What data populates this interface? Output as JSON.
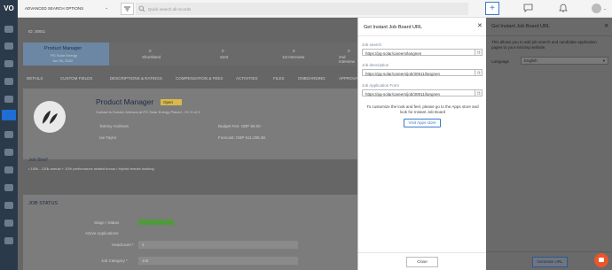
{
  "app": {
    "logo": "VO"
  },
  "topbar": {
    "search_options": "ADVANCED SEARCH OPTIONS",
    "search_placeholder": "Quick search all records"
  },
  "job": {
    "id_label": "ID: 30911",
    "title": "Product Manager",
    "status": "Open",
    "contact": "Contact is Donald Johnson at PG Solar Energy Placed - HC 0 of 3",
    "owner1": "Tammy Andrews",
    "owner2": "Ian Taylor",
    "budget_label": "Budget Fee: GBP 65.00",
    "forecast_label": "Forecast: GBP 611,295.38",
    "brief_title": "Job Brief",
    "brief_text": "• 100k - 120k annual + 10% performance related bonus • Hybrid remote working",
    "section_title": "JOB STATUS",
    "stage_label": "Stage / Status",
    "active_label": "Active Applications",
    "headcount_label": "Headcount *",
    "headcount_value": "3",
    "category_label": "Job Category *",
    "category_value": "Job"
  },
  "pipeline": {
    "stage1": "Product Manager",
    "stage1_sub": "PG Solar Energy",
    "stage1_date": "Jun 30, 2022",
    "stages": [
      {
        "label": "Shortlisted",
        "count": "0"
      },
      {
        "label": "Sent",
        "count": "0"
      },
      {
        "label": "1st Interview",
        "count": "0"
      },
      {
        "label": "2nd Interview",
        "count": "0"
      }
    ]
  },
  "tabs": [
    "DETAILS",
    "CUSTOM FIELDS",
    "DESCRIPTIONS & RATINGS",
    "COMPENSATION & FEES",
    "ACTIVITIES",
    "FILES",
    "ONBOARDING",
    "APPROVALS"
  ],
  "modal": {
    "title": "Get Instant Job Board URL",
    "close_symbol": "✕",
    "job_search_label": "Job search",
    "job_search_value": "https://pg-solar/careers/langnen",
    "job_description_label": "Job description",
    "job_description_value": "https://pg-solar/careers/job/30911/langnen",
    "job_application_label": "Job Application Form",
    "job_application_value": "https://pg-solar/careers/job/30911/langnen",
    "copy_symbol": "❐",
    "info_text": "To customize the look and feel, please go to the Apps store and look for Instant Job Board",
    "visit_button": "Visit Apps store",
    "close_button": "Close"
  },
  "panel": {
    "title": "Get Instant Job Board URL",
    "close_symbol": "✕",
    "description": "This allows you to add job search and candidate application pages to your existing website.",
    "language_label": "Language",
    "language_value": "English",
    "generate_button": "Generate URL"
  },
  "notif_badge_color": "#e8572a"
}
